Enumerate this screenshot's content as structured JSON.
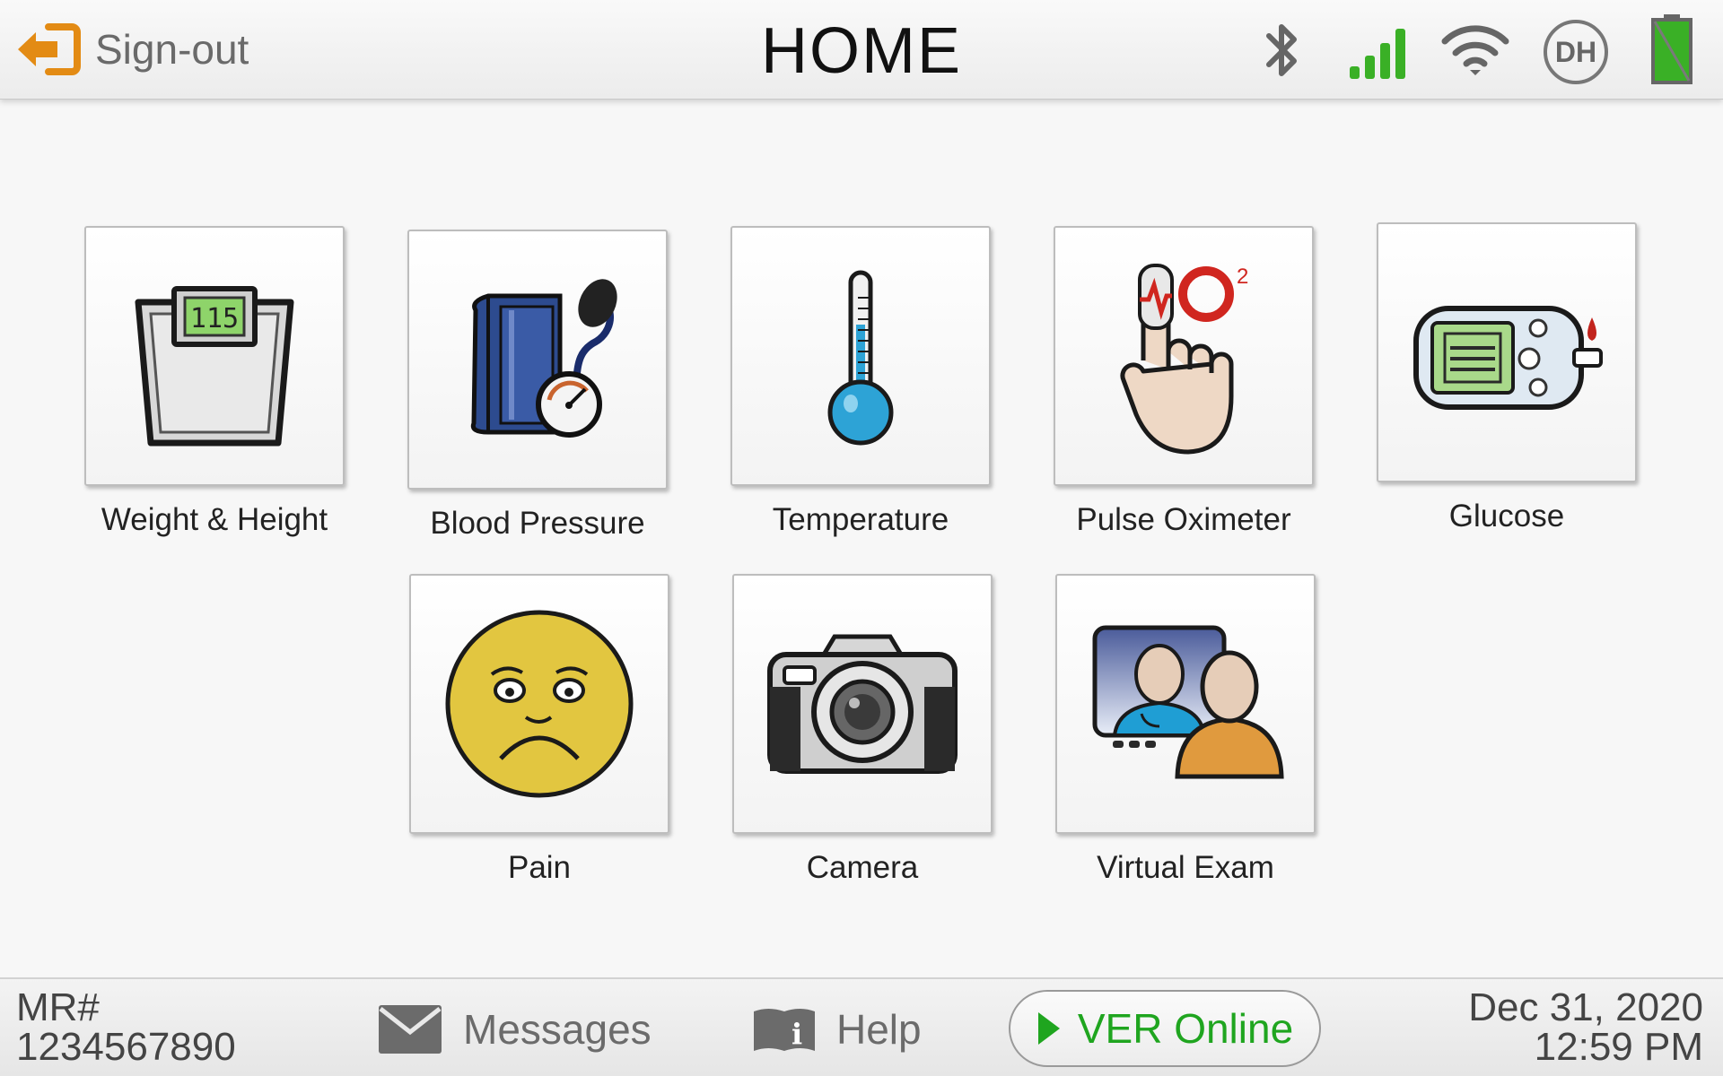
{
  "header": {
    "signout_label": "Sign-out",
    "title": "HOME",
    "user_initials": "DH",
    "icons": [
      "bluetooth-icon",
      "cell-signal-icon",
      "wifi-icon",
      "user-avatar-icon",
      "battery-icon"
    ]
  },
  "tiles": [
    {
      "label": "Weight & Height",
      "icon": "scale-icon",
      "scale_display": "115"
    },
    {
      "label": "Blood Pressure",
      "icon": "blood-pressure-cuff-icon"
    },
    {
      "label": "Temperature",
      "icon": "thermometer-icon"
    },
    {
      "label": "Pulse Oximeter",
      "icon": "pulse-oximeter-icon",
      "o2_symbol": "O",
      "o2_sub": "2"
    },
    {
      "label": "Glucose",
      "icon": "glucose-meter-icon"
    },
    {
      "label": "Pain",
      "icon": "sad-face-icon"
    },
    {
      "label": "Camera",
      "icon": "camera-icon"
    },
    {
      "label": "Virtual Exam",
      "icon": "video-call-icon"
    }
  ],
  "footer": {
    "mr_label": "MR#",
    "mr_number": "1234567890",
    "messages_label": "Messages",
    "help_label": "Help",
    "ver_online_label": "VER Online",
    "date": "Dec 31, 2020",
    "time": "12:59 PM"
  },
  "colors": {
    "signout_accent": "#e38b14",
    "signal_green": "#3ab026",
    "online_green": "#1fa51f"
  }
}
